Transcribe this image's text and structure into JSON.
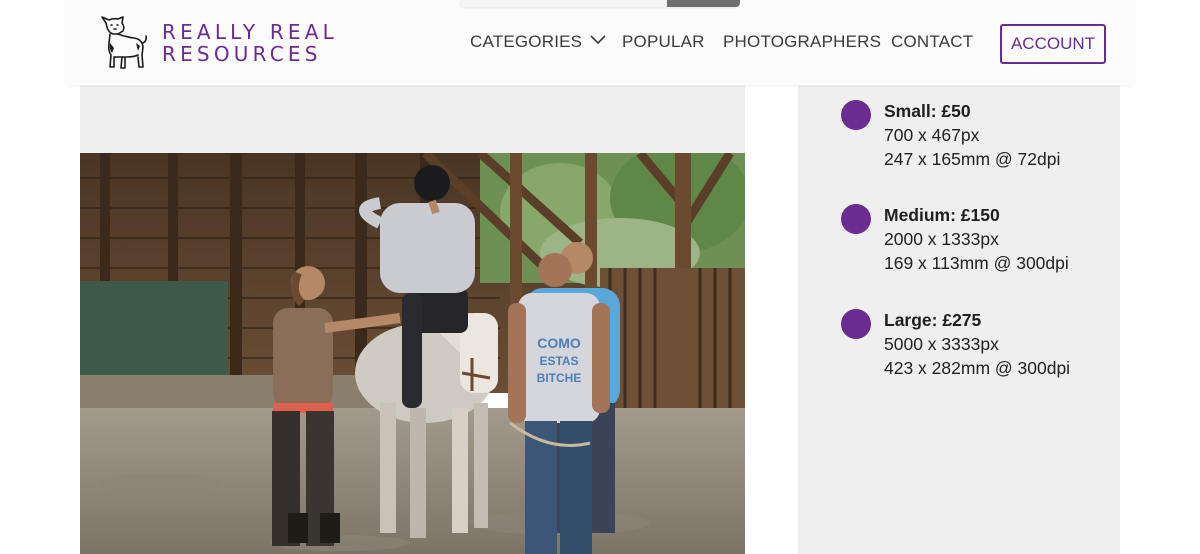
{
  "brand": {
    "line1": "REALLY REAL",
    "line2": "RESOURCES",
    "accent_color": "#6a2c91",
    "logo_icon": "dog-icon"
  },
  "nav": {
    "categories": "CATEGORIES",
    "popular": "POPULAR",
    "photographers": "PHOTOGRAPHERS",
    "contact": "CONTACT",
    "account": "ACCOUNT"
  },
  "photo": {
    "shirt_text_line1": "COMO",
    "shirt_text_line2": "ESTAS",
    "shirt_text_line3": "BITCHE"
  },
  "sizes": [
    {
      "title": "Small: £50",
      "pixels": "700 x 467px",
      "print": "247 x 165mm @ 72dpi"
    },
    {
      "title": "Medium: £150",
      "pixels": "2000 x 1333px",
      "print": "169 x 113mm @ 300dpi"
    },
    {
      "title": "Large: £275",
      "pixels": "5000 x 3333px",
      "print": "423 x 282mm @ 300dpi"
    }
  ]
}
